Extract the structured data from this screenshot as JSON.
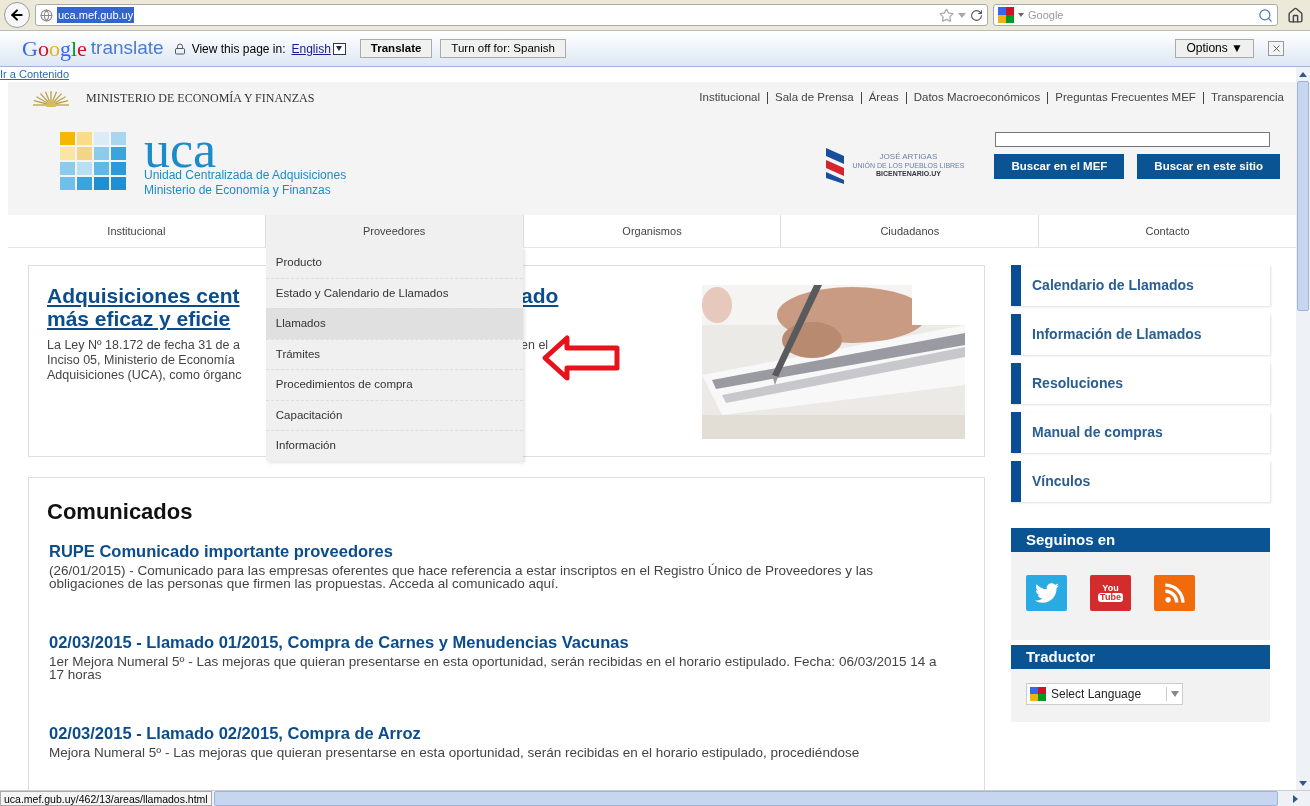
{
  "browser": {
    "url": "uca.mef.gub.uy",
    "search_placeholder": "Google"
  },
  "translate_bar": {
    "logo_google": "Google",
    "logo_translate": "translate",
    "prompt": "View this page in:",
    "language": "English",
    "translate_button": "Translate",
    "turn_off_button": "Turn off for: Spanish",
    "options_button": "Options ▼"
  },
  "skip_link": "Ir a Contenido",
  "header": {
    "ministry": "MINISTERIO DE ECONOMÍA Y FINANZAS",
    "top_links": [
      "Institucional",
      "Sala de Prensa",
      "Áreas",
      "Datos Macroeconómicos",
      "Preguntas Frecuentes MEF",
      "Transparencia"
    ],
    "logo": {
      "wordmark": "uca",
      "line1": "Unidad Centralizada de Adquisiciones",
      "line2": "Ministerio de Economía y Finanzas"
    },
    "bicentenario": {
      "title": "JOSÉ ARTIGAS",
      "subtitle": "UNIÓN DE LOS PUEBLOS LIBRES",
      "site": "BICENTENARIO.UY"
    },
    "search_buttons": [
      "Buscar en el MEF",
      "Buscar en este sitio"
    ]
  },
  "nav": [
    {
      "label": "Institucional",
      "selected": false
    },
    {
      "label": "Proveedores",
      "selected": true
    },
    {
      "label": "Organismos",
      "selected": false
    },
    {
      "label": "Ciudadanos",
      "selected": false
    },
    {
      "label": "Contacto",
      "selected": false
    }
  ],
  "dropdown": [
    {
      "label": "Producto",
      "selected": false
    },
    {
      "label": "Estado y Calendario de Llamados",
      "selected": false
    },
    {
      "label": "Llamados",
      "selected": true
    },
    {
      "label": "Trámites",
      "selected": false
    },
    {
      "label": "Procedimientos de compra",
      "selected": false
    },
    {
      "label": "Capacitación",
      "selected": false
    },
    {
      "label": "Información",
      "selected": false
    }
  ],
  "intro": {
    "title_lines": [
      {
        "left": "Adquisiciones cent",
        "right": "ado"
      },
      {
        "left": "más eficaz y eficie"
      }
    ],
    "text_lines": [
      {
        "left": "La Ley Nº 18.172 de fecha 31 de a",
        "right": "en el"
      },
      {
        "left": "Inciso 05, Ministerio de Economía"
      },
      {
        "left": "Adquisiciones (UCA), como órganc"
      }
    ]
  },
  "comunicados": {
    "title": "Comunicados",
    "items": [
      {
        "title": "RUPE Comunicado importante proveedores",
        "text": "(26/01/2015) - Comunicado para las empresas oferentes que hace referencia a estar inscriptos en el Registro Único de Proveedores y las obligaciones de las personas que firmen las propuestas. Acceda al comunicado aquí."
      },
      {
        "title": "02/03/2015 - Llamado 01/2015, Compra de Carnes y Menudencias Vacunas",
        "text": "1er Mejora Numeral 5º - Las mejoras que quieran presentarse en esta oportunidad, serán recibidas en el horario estipulado. Fecha: 06/03/2015 14 a 17 horas"
      },
      {
        "title": "02/03/2015 - Llamado 02/2015, Compra de Arroz",
        "text": "Mejora Numeral 5º - Las mejoras que quieran presentarse en esta oportunidad, serán recibidas en el horario estipulado, procediéndose"
      }
    ]
  },
  "sidebar": {
    "links": [
      "Calendario de Llamados",
      "Información de Llamados",
      "Resoluciones",
      "Manual de compras",
      "Vínculos"
    ],
    "social": {
      "title": "Seguinos en",
      "youtube_label": [
        "You",
        "Tube"
      ]
    },
    "translator": {
      "title": "Traductor",
      "select": "Select Language"
    }
  },
  "status_url": "uca.mef.gub.uy/462/13/areas/llamados.html"
}
